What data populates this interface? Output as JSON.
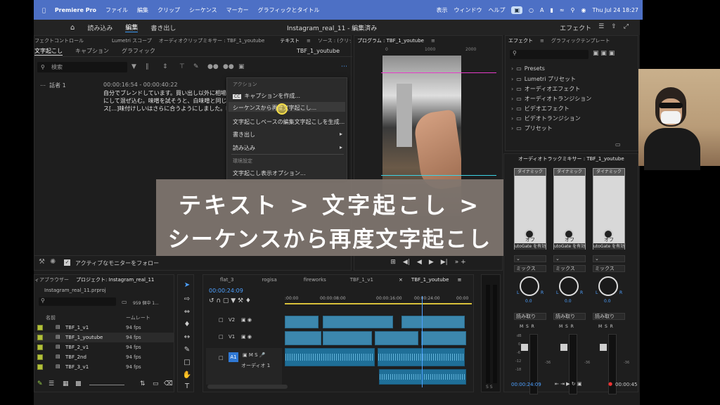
{
  "menubar": {
    "app": "Premiere Pro",
    "items": [
      "ファイル",
      "編集",
      "クリップ",
      "シーケンス",
      "マーカー",
      "グラフィックとタイトル"
    ],
    "right": [
      "表示",
      "ウィンドウ",
      "ヘルプ"
    ],
    "clock": "Thu Jul 24  18:27"
  },
  "topbar": {
    "workspaces": [
      "読み込み",
      "編集",
      "書き出し"
    ],
    "doc_title": "Instagram_real_11 - 編集済み",
    "right_label": "エフェクト"
  },
  "text_panel": {
    "tabs": [
      "フェクトコントロール",
      "Lumetri スコープ",
      "オーディオクリップミキサー : TBF_1_youtube",
      "テキスト",
      "ソース : (クリップ"
    ],
    "subtabs": [
      "文字起こし",
      "キャプション",
      "グラフィック"
    ],
    "sequence": "TBF_1_youtube",
    "search_placeholder": "検索",
    "speaker": "話者 1",
    "timecode": "00:00:16:54 - 00:00:40:22",
    "lines": [
      "自分でブレンドしています。買い出し以外に相場が",
      "にして混ぜ込む。味噌を試そうと、白味噌と同じ4",
      "ス[…]味付けしいはさらに合うようにしました。味"
    ],
    "follow_label": "アクティブなモニターをフォロー"
  },
  "context_menu": {
    "header1": "アクション",
    "create_captions": "キャプションを作成...",
    "retranscribe": "シーケンスから再度文字起こし...",
    "transcript_edit": "文字起こしベースの編集文字起こしを生成...",
    "export": "書き出し",
    "import": "読み込み",
    "header2": "環境設定",
    "display_options": "文字起こし表示オプション..."
  },
  "program": {
    "title": "プログラム : TBF_1_youtube",
    "ruler": [
      "0",
      "1000",
      "2000"
    ]
  },
  "effects": {
    "tabs": [
      "エフェクト",
      "グラフィックテンプレート"
    ],
    "items": [
      "Presets",
      "Lumetri プリセット",
      "オーディオエフェクト",
      "オーディオトランジション",
      "ビデオエフェクト",
      "ビデオトランジション",
      "プリセット"
    ]
  },
  "mixer": {
    "title": "オーディオトラックミキサー : TBF_1_youtube",
    "dyn": "ダイナミック",
    "off": "オフ",
    "autogate": "utoGate を有効",
    "mix": "ミックス",
    "val": "0.0",
    "read": "読み取り",
    "db_labels": [
      "dB",
      "0",
      "-6",
      "-12",
      "-18",
      "-24",
      "-30",
      "-36"
    ],
    "bottom_time": "00:00:24:09",
    "bottom_right": "00:00:45"
  },
  "project": {
    "tabs": [
      "ィアブラウザー",
      "プロジェクト: Instagram_real_11"
    ],
    "file": "Instagram_real_11.prproj",
    "count": "959 個中 1...",
    "col_name": "名前",
    "col_fps": "ームレート",
    "rows": [
      {
        "name": "TBF_1_v1",
        "fps": "94 fps"
      },
      {
        "name": "TBF_1_youtube",
        "fps": "94 fps"
      },
      {
        "name": "TBF_2_v1",
        "fps": "94 fps"
      },
      {
        "name": "TBF_2nd",
        "fps": "94 fps"
      },
      {
        "name": "TBF_3_v1",
        "fps": "94 fps"
      }
    ]
  },
  "timeline": {
    "tabs": [
      "flat_3",
      "rogisa",
      "fireworks",
      "TBF_1_v1",
      "TBF_1_youtube"
    ],
    "current": "00:00:24:09",
    "ruler": [
      ":00:00",
      "00:00:08:00",
      "00:00:16:00",
      "00:00:24:00",
      "00:00"
    ],
    "tracks": [
      "V2",
      "V1",
      "A1"
    ],
    "a1_name": "オーディオ 1"
  },
  "banner": {
    "line1": "テキスト > 文字起こし >",
    "line2": "シーケンスから再度文字起こし"
  },
  "colors": {
    "menubar": "#4d70c5",
    "accent": "#4da0ff",
    "clip": "#3c87ad",
    "banner": "#807670"
  }
}
